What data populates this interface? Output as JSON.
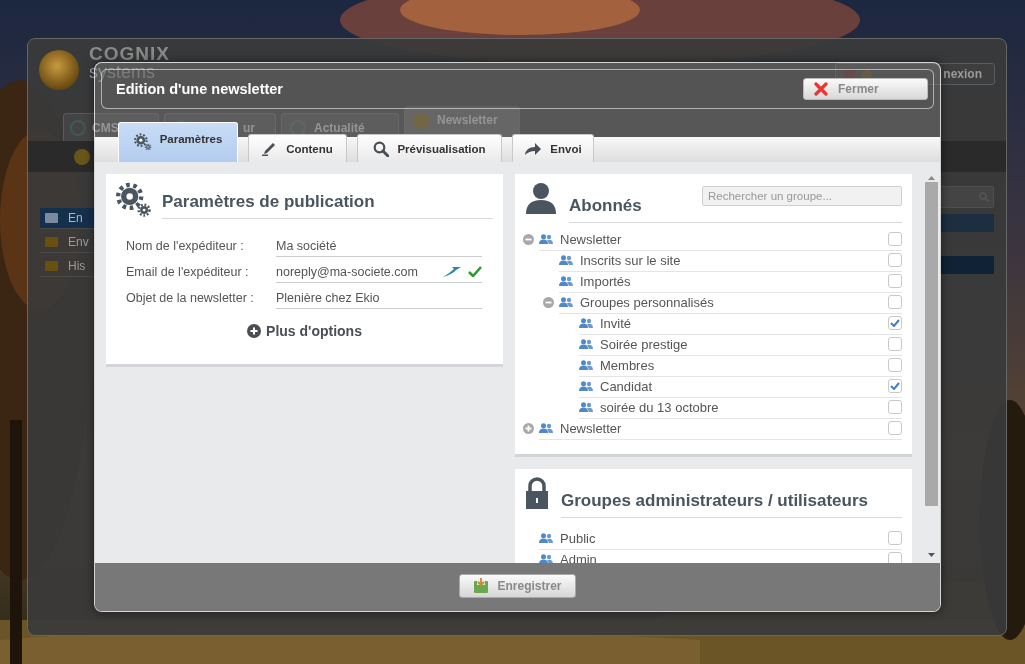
{
  "background_app": {
    "logo": {
      "name": "COGNIX",
      "tagline": "systems"
    },
    "logout_button": "nexion",
    "tabs": [
      {
        "label": "CMS",
        "selected": false
      },
      {
        "label": "ur",
        "selected": false
      },
      {
        "label": "Actualité",
        "selected": false
      },
      {
        "label": "Newsletter",
        "selected": true
      }
    ],
    "sidebar": [
      {
        "label": "En",
        "selected": true
      },
      {
        "label": "Env",
        "selected": false
      },
      {
        "label": "His",
        "selected": false
      }
    ]
  },
  "dialog": {
    "title": "Edition d'une newsletter",
    "close_button": "Fermer",
    "tabs": [
      {
        "label": "Paramètres",
        "selected": true
      },
      {
        "label": "Contenu",
        "selected": false
      },
      {
        "label": "Prévisualisation",
        "selected": false
      },
      {
        "label": "Envoi",
        "selected": false
      }
    ],
    "publication": {
      "title": "Paramètres de publication",
      "fields": [
        {
          "kind": "text",
          "label": "Nom de l'expéditeur :",
          "value": "Ma société"
        },
        {
          "kind": "email",
          "label": "Email de l'expéditeur :",
          "value": "noreply@ma-societe.com",
          "valid": true
        },
        {
          "kind": "text",
          "label": "Objet de la newsletter :",
          "value": "Plenière chez Ekio"
        }
      ],
      "more_options": "Plus d'options"
    },
    "subscribers": {
      "title": "Abonnés",
      "search": {
        "placeholder": "Rechercher un groupe..."
      },
      "groups": [
        {
          "label": "Newsletter",
          "expanded": true,
          "checked": false,
          "children": [
            {
              "label": "Inscrits sur le site",
              "checked": false
            },
            {
              "label": "Importés",
              "checked": false
            },
            {
              "label": "Groupes personnalisés",
              "expanded": true,
              "checked": false,
              "children": [
                {
                  "label": "Invité",
                  "checked": true
                },
                {
                  "label": "Soirée prestige",
                  "checked": false
                },
                {
                  "label": "Membres",
                  "checked": false
                },
                {
                  "label": "Candidat",
                  "checked": true
                },
                {
                  "label": "soirée du 13 octobre",
                  "checked": false
                }
              ]
            }
          ]
        },
        {
          "label": "Newsletter",
          "expanded": false,
          "checked": false
        }
      ]
    },
    "admin_groups": {
      "title": "Groupes administrateurs / utilisateurs",
      "groups": [
        {
          "label": "Public",
          "checked": false
        },
        {
          "label": "Admin",
          "checked": false
        }
      ]
    },
    "save_button": "Enregistrer"
  }
}
